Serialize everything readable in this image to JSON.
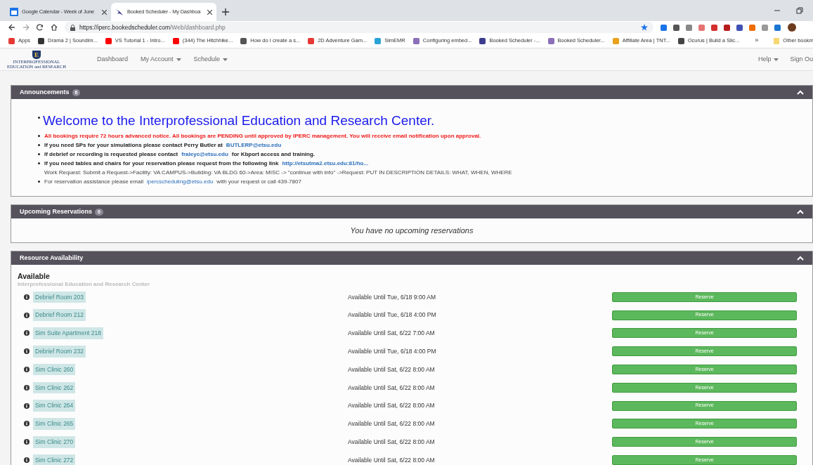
{
  "browser": {
    "tabs": [
      {
        "title": "Google Calendar - Week of June",
        "selected": false
      },
      {
        "title": "Booked Scheduler - My Dashboa",
        "selected": true
      }
    ],
    "url_host": "https://iperc.bookedscheduler.com",
    "url_path": "/Web/dashboard.php",
    "bookmarks": [
      {
        "label": "Apps",
        "color": "#e53935"
      },
      {
        "label": "Drama 2 | Soundim...",
        "color": "#333333"
      },
      {
        "label": "VS Tutorial 1 - Intro...",
        "color": "#ff0000"
      },
      {
        "label": "(344) The Hitchhike...",
        "color": "#ff0000"
      },
      {
        "label": "How do I create a s...",
        "color": "#555555"
      },
      {
        "label": "2D Adventure Gam...",
        "color": "#e53935"
      },
      {
        "label": "SimEMR",
        "color": "#29a3d6"
      },
      {
        "label": "Configuring embed...",
        "color": "#8b6fb8"
      },
      {
        "label": "Booked Scheduler -...",
        "color": "#3d3d8f"
      },
      {
        "label": "Booked Scheduler...",
        "color": "#8b6fb8"
      },
      {
        "label": "Affiliate Area | TNT...",
        "color": "#e8a11a"
      },
      {
        "label": "Ocurus | Build a Slic...",
        "color": "#444444"
      }
    ],
    "more": "»",
    "other_bookmarks": "Other bookm"
  },
  "nav": {
    "logo_letter": "E",
    "logo_line1": "INTERPROFESSIONAL",
    "logo_line2": "EDUCATION and RESEARCH",
    "items": [
      {
        "label": "Dashboard",
        "dropdown": false
      },
      {
        "label": "My Account",
        "dropdown": true
      },
      {
        "label": "Schedule",
        "dropdown": true
      }
    ],
    "right_items": [
      {
        "label": "Help",
        "dropdown": true
      },
      {
        "label": "Sign Ou",
        "dropdown": false
      }
    ]
  },
  "announcements": {
    "title": "Announcements",
    "count": "6",
    "items": [
      {
        "kind": "headline",
        "text": "Welcome to the Interprofessional Education and Research Center."
      },
      {
        "kind": "alert",
        "text": "All bookings require 72 hours advanced notice. All bookings are PENDING until approved by IPERC management. You will receive email notification upon approval."
      },
      {
        "kind": "bold",
        "text": "If you need SPs for your simulations please contact Perry Butler at",
        "link": "BUTLERP@etsu.edu"
      },
      {
        "kind": "bold",
        "text": "If debrief or recording is requested please contact",
        "link": "fraleyc@etsu.edu",
        "after": "for Kbport access and training."
      },
      {
        "kind": "bold",
        "text": "If you need tables and chairs for your reservation please request from the following link",
        "link": "http://etsutma2.etsu.edu:81/ho...",
        "note": "Work Request: Submit a Request->Facility: VA CAMPUS->Building: VA BLDG 60->Area: MISC -> \"continue with info\" ->Request: PUT IN DESCRIPTION DETAILS: WHAT, WHEN, WHERE"
      },
      {
        "kind": "plain",
        "text": "For reservation assistance please email",
        "link": "ipercscheduling@etsu.edu",
        "after": "with your request or call 439-7807"
      }
    ]
  },
  "upcoming": {
    "title": "Upcoming Reservations",
    "count": "0",
    "empty_message": "You have no upcoming reservations"
  },
  "availability": {
    "title": "Resource Availability",
    "heading": "Available",
    "subheading": "Interprofessional Education and Research Center",
    "resources": [
      {
        "name": "Debrief Room 203",
        "status": "Available Until Tue, 6/18 9:00 AM",
        "action": "Reserve"
      },
      {
        "name": "Debrief Room 212",
        "status": "Available Until Tue, 6/18 4:00 PM",
        "action": "Reserve"
      },
      {
        "name": "Sim Suite Apartment 218",
        "status": "Available Until Sat, 6/22 7:00 AM",
        "action": "Reserve"
      },
      {
        "name": "Debrief Room 232",
        "status": "Available Until Tue, 6/18 4:00 PM",
        "action": "Reserve"
      },
      {
        "name": "Sim Clinic 260",
        "status": "Available Until Sat, 6/22 8:00 AM",
        "action": "Reserve"
      },
      {
        "name": "Sim Clinic 262",
        "status": "Available Until Sat, 6/22 8:00 AM",
        "action": "Reserve"
      },
      {
        "name": "Sim Clinic 264",
        "status": "Available Until Sat, 6/22 8:00 AM",
        "action": "Reserve"
      },
      {
        "name": "Sim Clinic 265",
        "status": "Available Until Sat, 6/22 8:00 AM",
        "action": "Reserve"
      },
      {
        "name": "Sim Clinic 270",
        "status": "Available Until Sat, 6/22 8:00 AM",
        "action": "Reserve"
      },
      {
        "name": "Sim Clinic 272",
        "status": "Available Until Sat, 6/22 8:00 AM",
        "action": "Reserve"
      }
    ]
  }
}
